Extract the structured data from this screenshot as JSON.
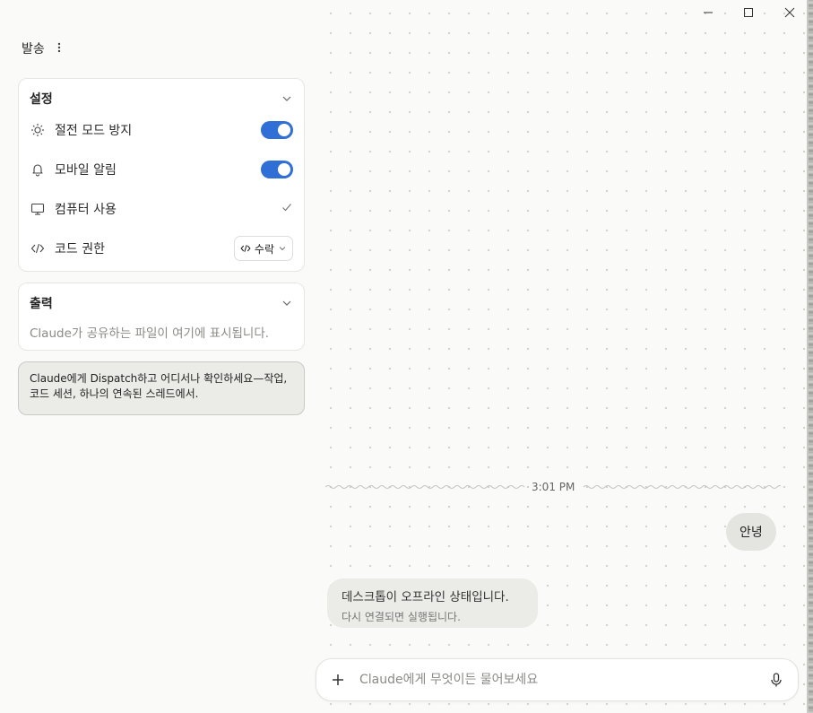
{
  "header": {
    "title": "발송"
  },
  "settings": {
    "title": "설정",
    "items": [
      {
        "label": "절전 모드 방지",
        "icon": "sun-icon",
        "state": "on"
      },
      {
        "label": "모바일 알림",
        "icon": "bell-icon",
        "state": "on"
      },
      {
        "label": "컴퓨터 사용",
        "icon": "monitor-icon",
        "state": "checked"
      },
      {
        "label": "코드 권한",
        "icon": "code-icon",
        "value": "수락"
      }
    ]
  },
  "output": {
    "title": "출력",
    "empty_text": "Claude가 공유하는 파일이 여기에 표시됩니다."
  },
  "tip": {
    "text": "Claude에게 Dispatch하고 어디서나 확인하세요—작업, 코드 세션, 하나의 연속된 스레드에서."
  },
  "chat": {
    "timestamp": "3:01 PM",
    "user_message": "안녕",
    "system_message": {
      "title": "데스크톱이 오프라인 상태입니다.",
      "subtitle": "다시 연결되면 실행됩니다."
    }
  },
  "composer": {
    "placeholder": "Claude에게 무엇이든 물어보세요"
  },
  "colors": {
    "toggle_on": "#2f6fd6",
    "background": "#fafaf8",
    "bubble": "#e4e4e1"
  }
}
